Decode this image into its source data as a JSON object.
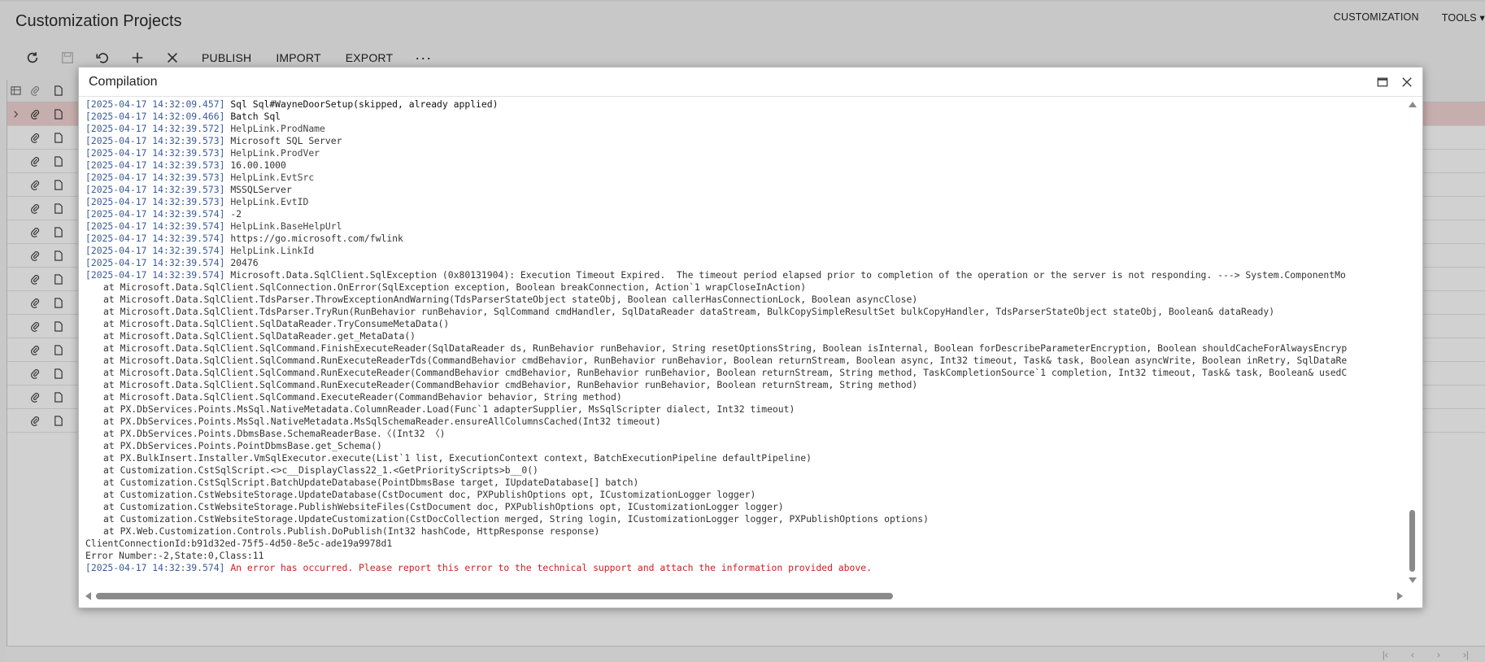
{
  "page": {
    "title": "Customization Projects",
    "menu": [
      "CUSTOMIZATION",
      "TOOLS ▾"
    ]
  },
  "toolbar": {
    "icons": [
      "refresh-icon",
      "save-icon",
      "undo-icon",
      "add-icon",
      "delete-icon"
    ],
    "publish_label": "PUBLISH",
    "import_label": "IMPORT",
    "export_label": "EXPORT",
    "more_label": "···"
  },
  "grid": {
    "header_icons": [
      "select-all-icon",
      "attachment-icon",
      "file-icon"
    ],
    "row_icons": [
      "attachment-icon",
      "file-icon"
    ],
    "selected_row_index": 0,
    "row_count": 14
  },
  "dialog": {
    "title": "Compilation",
    "log": [
      {
        "ts": "[2025-04-17 14:32:09.457]",
        "text": "Sql Sql#WayneDoorSetup(skipped, already applied)",
        "style": "bold"
      },
      {
        "ts": "[2025-04-17 14:32:09.466]",
        "text": "Batch Sql",
        "style": "bold"
      },
      {
        "ts": "[2025-04-17 14:32:39.572]",
        "text": "HelpLink.ProdName",
        "style": "muted"
      },
      {
        "ts": "[2025-04-17 14:32:39.573]",
        "text": "Microsoft SQL Server",
        "style": "plain"
      },
      {
        "ts": "[2025-04-17 14:32:39.573]",
        "text": "HelpLink.ProdVer",
        "style": "muted"
      },
      {
        "ts": "[2025-04-17 14:32:39.573]",
        "text": "16.00.1000",
        "style": "plain"
      },
      {
        "ts": "[2025-04-17 14:32:39.573]",
        "text": "HelpLink.EvtSrc",
        "style": "muted"
      },
      {
        "ts": "[2025-04-17 14:32:39.573]",
        "text": "MSSQLServer",
        "style": "plain"
      },
      {
        "ts": "[2025-04-17 14:32:39.573]",
        "text": "HelpLink.EvtID",
        "style": "muted"
      },
      {
        "ts": "[2025-04-17 14:32:39.574]",
        "text": "-2",
        "style": "plain"
      },
      {
        "ts": "[2025-04-17 14:32:39.574]",
        "text": "HelpLink.BaseHelpUrl",
        "style": "muted"
      },
      {
        "ts": "[2025-04-17 14:32:39.574]",
        "text": "https://go.microsoft.com/fwlink",
        "style": "plain"
      },
      {
        "ts": "[2025-04-17 14:32:39.574]",
        "text": "HelpLink.LinkId",
        "style": "muted"
      },
      {
        "ts": "[2025-04-17 14:32:39.574]",
        "text": "20476",
        "style": "plain"
      },
      {
        "ts": "[2025-04-17 14:32:39.574]",
        "text": "Microsoft.Data.SqlClient.SqlException (0x80131904): Execution Timeout Expired.  The timeout period elapsed prior to completion of the operation or the server is not responding. ---> System.ComponentMo",
        "style": "plain"
      },
      {
        "ts": "",
        "text": "at Microsoft.Data.SqlClient.SqlConnection.OnError(SqlException exception, Boolean breakConnection, Action`1 wrapCloseInAction)",
        "style": "stack"
      },
      {
        "ts": "",
        "text": "at Microsoft.Data.SqlClient.TdsParser.ThrowExceptionAndWarning(TdsParserStateObject stateObj, Boolean callerHasConnectionLock, Boolean asyncClose)",
        "style": "stack"
      },
      {
        "ts": "",
        "text": "at Microsoft.Data.SqlClient.TdsParser.TryRun(RunBehavior runBehavior, SqlCommand cmdHandler, SqlDataReader dataStream, BulkCopySimpleResultSet bulkCopyHandler, TdsParserStateObject stateObj, Boolean& dataReady)",
        "style": "stack"
      },
      {
        "ts": "",
        "text": "at Microsoft.Data.SqlClient.SqlDataReader.TryConsumeMetaData()",
        "style": "stack"
      },
      {
        "ts": "",
        "text": "at Microsoft.Data.SqlClient.SqlDataReader.get_MetaData()",
        "style": "stack"
      },
      {
        "ts": "",
        "text": "at Microsoft.Data.SqlClient.SqlCommand.FinishExecuteReader(SqlDataReader ds, RunBehavior runBehavior, String resetOptionsString, Boolean isInternal, Boolean forDescribeParameterEncryption, Boolean shouldCacheForAlwaysEncryp",
        "style": "stack"
      },
      {
        "ts": "",
        "text": "at Microsoft.Data.SqlClient.SqlCommand.RunExecuteReaderTds(CommandBehavior cmdBehavior, RunBehavior runBehavior, Boolean returnStream, Boolean async, Int32 timeout, Task& task, Boolean asyncWrite, Boolean inRetry, SqlDataRe",
        "style": "stack"
      },
      {
        "ts": "",
        "text": "at Microsoft.Data.SqlClient.SqlCommand.RunExecuteReader(CommandBehavior cmdBehavior, RunBehavior runBehavior, Boolean returnStream, String method, TaskCompletionSource`1 completion, Int32 timeout, Task& task, Boolean& usedC",
        "style": "stack"
      },
      {
        "ts": "",
        "text": "at Microsoft.Data.SqlClient.SqlCommand.RunExecuteReader(CommandBehavior cmdBehavior, RunBehavior runBehavior, Boolean returnStream, String method)",
        "style": "stack"
      },
      {
        "ts": "",
        "text": "at Microsoft.Data.SqlClient.SqlCommand.ExecuteReader(CommandBehavior behavior, String method)",
        "style": "stack"
      },
      {
        "ts": "",
        "text": "at PX.DbServices.Points.MsSql.NativeMetadata.ColumnReader.Load(Func`1 adapterSupplier, MsSqlScripter dialect, Int32 timeout)",
        "style": "stack"
      },
      {
        "ts": "",
        "text": "at PX.DbServices.Points.MsSql.NativeMetadata.MsSqlSchemaReader.ensureAllColumnsCached(Int32 timeout)",
        "style": "stack"
      },
      {
        "ts": "",
        "text": "at PX.DbServices.Points.DbmsBase.SchemaReaderBase.〈(Int32 〈)",
        "style": "stack"
      },
      {
        "ts": "",
        "text": "at PX.DbServices.Points.PointDbmsBase.get_Schema()",
        "style": "stack"
      },
      {
        "ts": "",
        "text": "at PX.BulkInsert.Installer.VmSqlExecutor.execute(List`1 list, ExecutionContext context, BatchExecutionPipeline defaultPipeline)",
        "style": "stack"
      },
      {
        "ts": "",
        "text": "at Customization.CstSqlScript.<>c__DisplayClass22_1.<GetPriorityScripts>b__0()",
        "style": "stack"
      },
      {
        "ts": "",
        "text": "at Customization.CstSqlScript.BatchUpdateDatabase(PointDbmsBase target, IUpdateDatabase[] batch)",
        "style": "stack"
      },
      {
        "ts": "",
        "text": "at Customization.CstWebsiteStorage.UpdateDatabase(CstDocument doc, PXPublishOptions opt, ICustomizationLogger logger)",
        "style": "stack"
      },
      {
        "ts": "",
        "text": "at Customization.CstWebsiteStorage.PublishWebsiteFiles(CstDocument doc, PXPublishOptions opt, ICustomizationLogger logger)",
        "style": "stack"
      },
      {
        "ts": "",
        "text": "at Customization.CstWebsiteStorage.UpdateCustomization(CstDocCollection merged, String login, ICustomizationLogger logger, PXPublishOptions options)",
        "style": "stack"
      },
      {
        "ts": "",
        "text": "at PX.Web.Customization.Controls.Publish.DoPublish(Int32 hashCode, HttpResponse response)",
        "style": "stack"
      },
      {
        "ts": "",
        "text": "ClientConnectionId:b91d32ed-75f5-4d50-8e5c-ade19a9978d1",
        "style": "plain"
      },
      {
        "ts": "",
        "text": "Error Number:-2,State:0,Class:11",
        "style": "plain"
      },
      {
        "ts": "[2025-04-17 14:32:39.574]",
        "text": "An error has occurred. Please report this error to the technical support and attach the information provided above.",
        "style": "err"
      }
    ]
  },
  "colors": {
    "timestamp": "#3b5b9a",
    "error": "#cc1f1f",
    "selected_row": "#f3d5d5"
  }
}
